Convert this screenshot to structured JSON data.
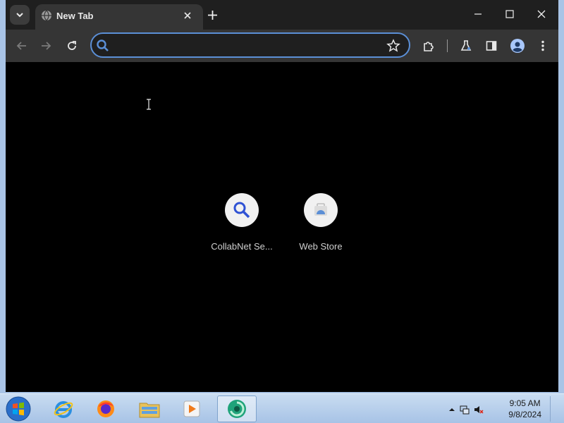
{
  "browser": {
    "tab": {
      "title": "New Tab"
    },
    "omnibox": {
      "value": "",
      "placeholder": ""
    }
  },
  "shortcuts": [
    {
      "label": "CollabNet Se..."
    },
    {
      "label": "Web Store"
    }
  ],
  "taskbar": {
    "clock": {
      "time": "9:05 AM",
      "date": "9/8/2024"
    }
  },
  "colors": {
    "accent": "#5b8fd6",
    "tabstrip": "#1f1f1f",
    "toolbar": "#353535",
    "taskbar": "#b9d1ee"
  }
}
